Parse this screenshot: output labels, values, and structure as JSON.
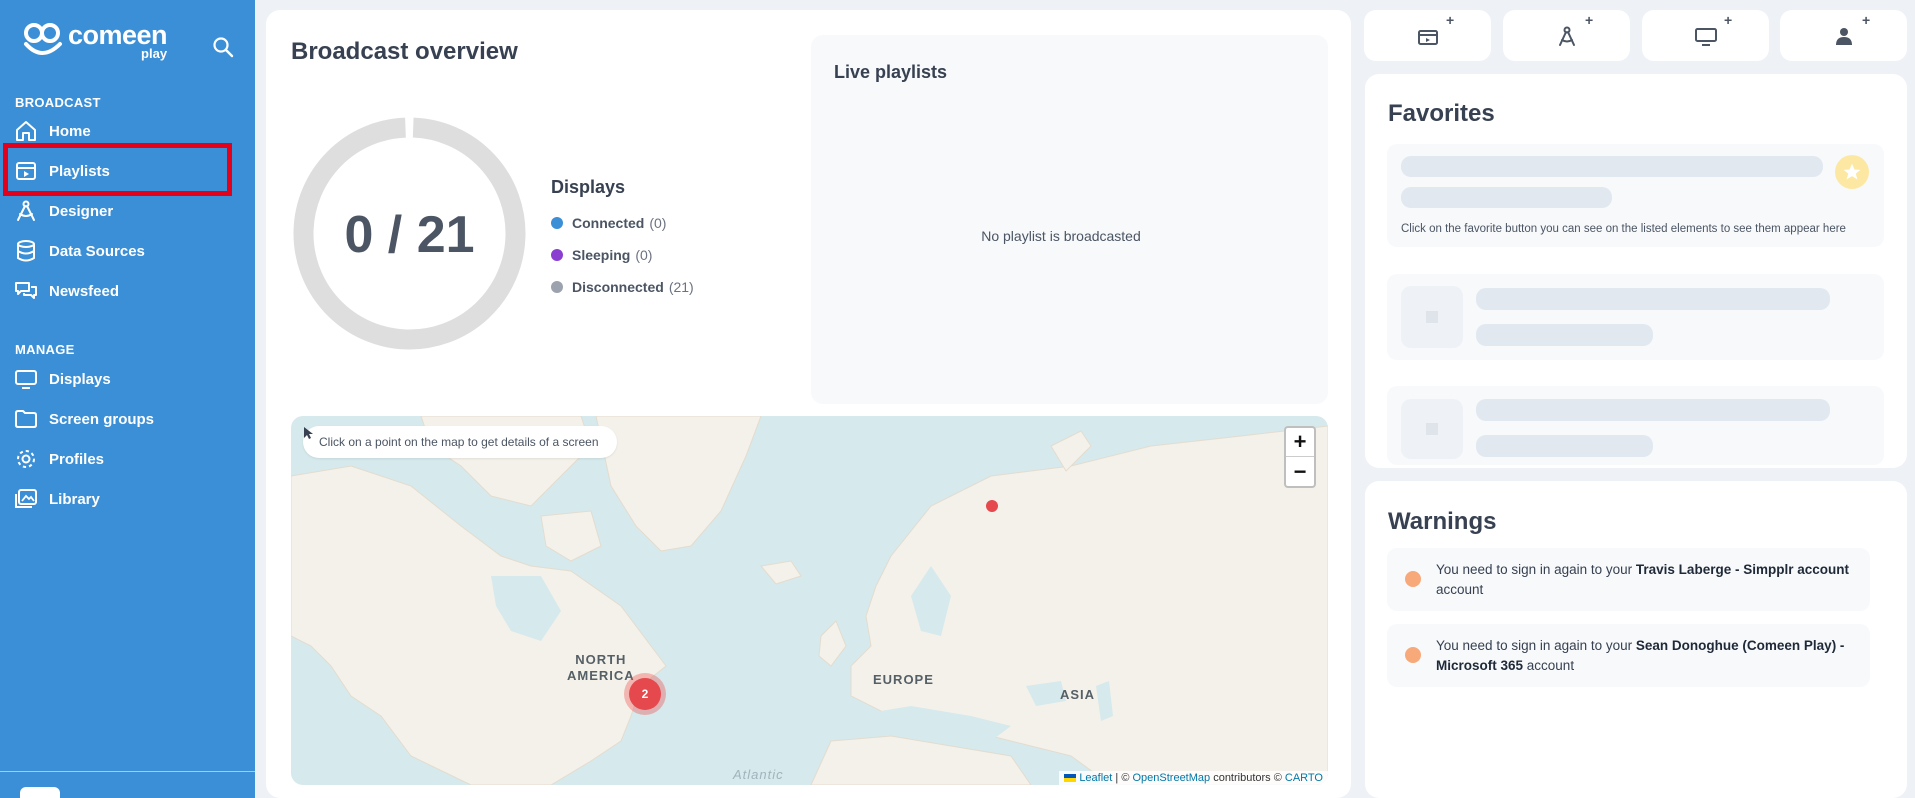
{
  "brand": {
    "name": "comeen",
    "sub": "play"
  },
  "sidebar": {
    "sections": [
      {
        "title": "BROADCAST",
        "items": [
          {
            "label": "Home",
            "icon": "home-icon"
          },
          {
            "label": "Playlists",
            "icon": "playlist-icon"
          },
          {
            "label": "Designer",
            "icon": "designer-icon"
          },
          {
            "label": "Data Sources",
            "icon": "database-icon"
          },
          {
            "label": "Newsfeed",
            "icon": "newsfeed-icon"
          }
        ]
      },
      {
        "title": "MANAGE",
        "items": [
          {
            "label": "Displays",
            "icon": "monitor-icon"
          },
          {
            "label": "Screen groups",
            "icon": "folder-icon"
          },
          {
            "label": "Profiles",
            "icon": "gear-icon"
          },
          {
            "label": "Library",
            "icon": "images-icon"
          }
        ]
      }
    ],
    "highlighted": "Playlists"
  },
  "overview": {
    "title": "Broadcast overview",
    "ratio": "0 / 21",
    "connected_fraction": 0,
    "displays_title": "Displays",
    "legend": [
      {
        "name": "Connected",
        "count": "(0)",
        "color": "#3b8fd6"
      },
      {
        "name": "Sleeping",
        "count": "(0)",
        "color": "#8b3fd1"
      },
      {
        "name": "Disconnected",
        "count": "(21)",
        "color": "#9ca3af"
      }
    ]
  },
  "live": {
    "title": "Live playlists",
    "empty": "No playlist is broadcasted"
  },
  "map": {
    "hint": "Click on a point on the map to get details of a screen",
    "zoom_in": "+",
    "zoom_out": "−",
    "labels": {
      "na_line1": "NORTH",
      "na_line2": "AMERICA",
      "europe": "EUROPE",
      "asia": "ASIA",
      "ocean": "Atlantic"
    },
    "cluster_count": "2",
    "attribution": {
      "leaflet": "Leaflet",
      "sep": " | © ",
      "osm": "OpenStreetMap",
      "contrib": " contributors © ",
      "carto": "CARTO"
    }
  },
  "quick_actions": [
    {
      "icon": "clapperboard-add-icon",
      "plus": "+"
    },
    {
      "icon": "compass-add-icon",
      "plus": "+"
    },
    {
      "icon": "monitor-add-icon",
      "plus": "+"
    },
    {
      "icon": "user-add-icon",
      "plus": "+"
    }
  ],
  "favorites": {
    "title": "Favorites",
    "hint": "Click on the favorite button you can see on the listed elements to see them appear here"
  },
  "warnings": {
    "title": "Warnings",
    "items": [
      {
        "prefix": "You need to sign in again to your ",
        "account": "Travis Laberge - Simpplr account",
        "suffix": " account"
      },
      {
        "prefix": "You need to sign in again to your ",
        "account": "Sean Donoghue (Comeen Play) - Microsoft 365",
        "suffix": " account"
      }
    ]
  },
  "colors": {
    "sidebar": "#3b8fd6",
    "highlight": "#e3001b",
    "marker": "#e5484d",
    "warning": "#f7a97a"
  }
}
